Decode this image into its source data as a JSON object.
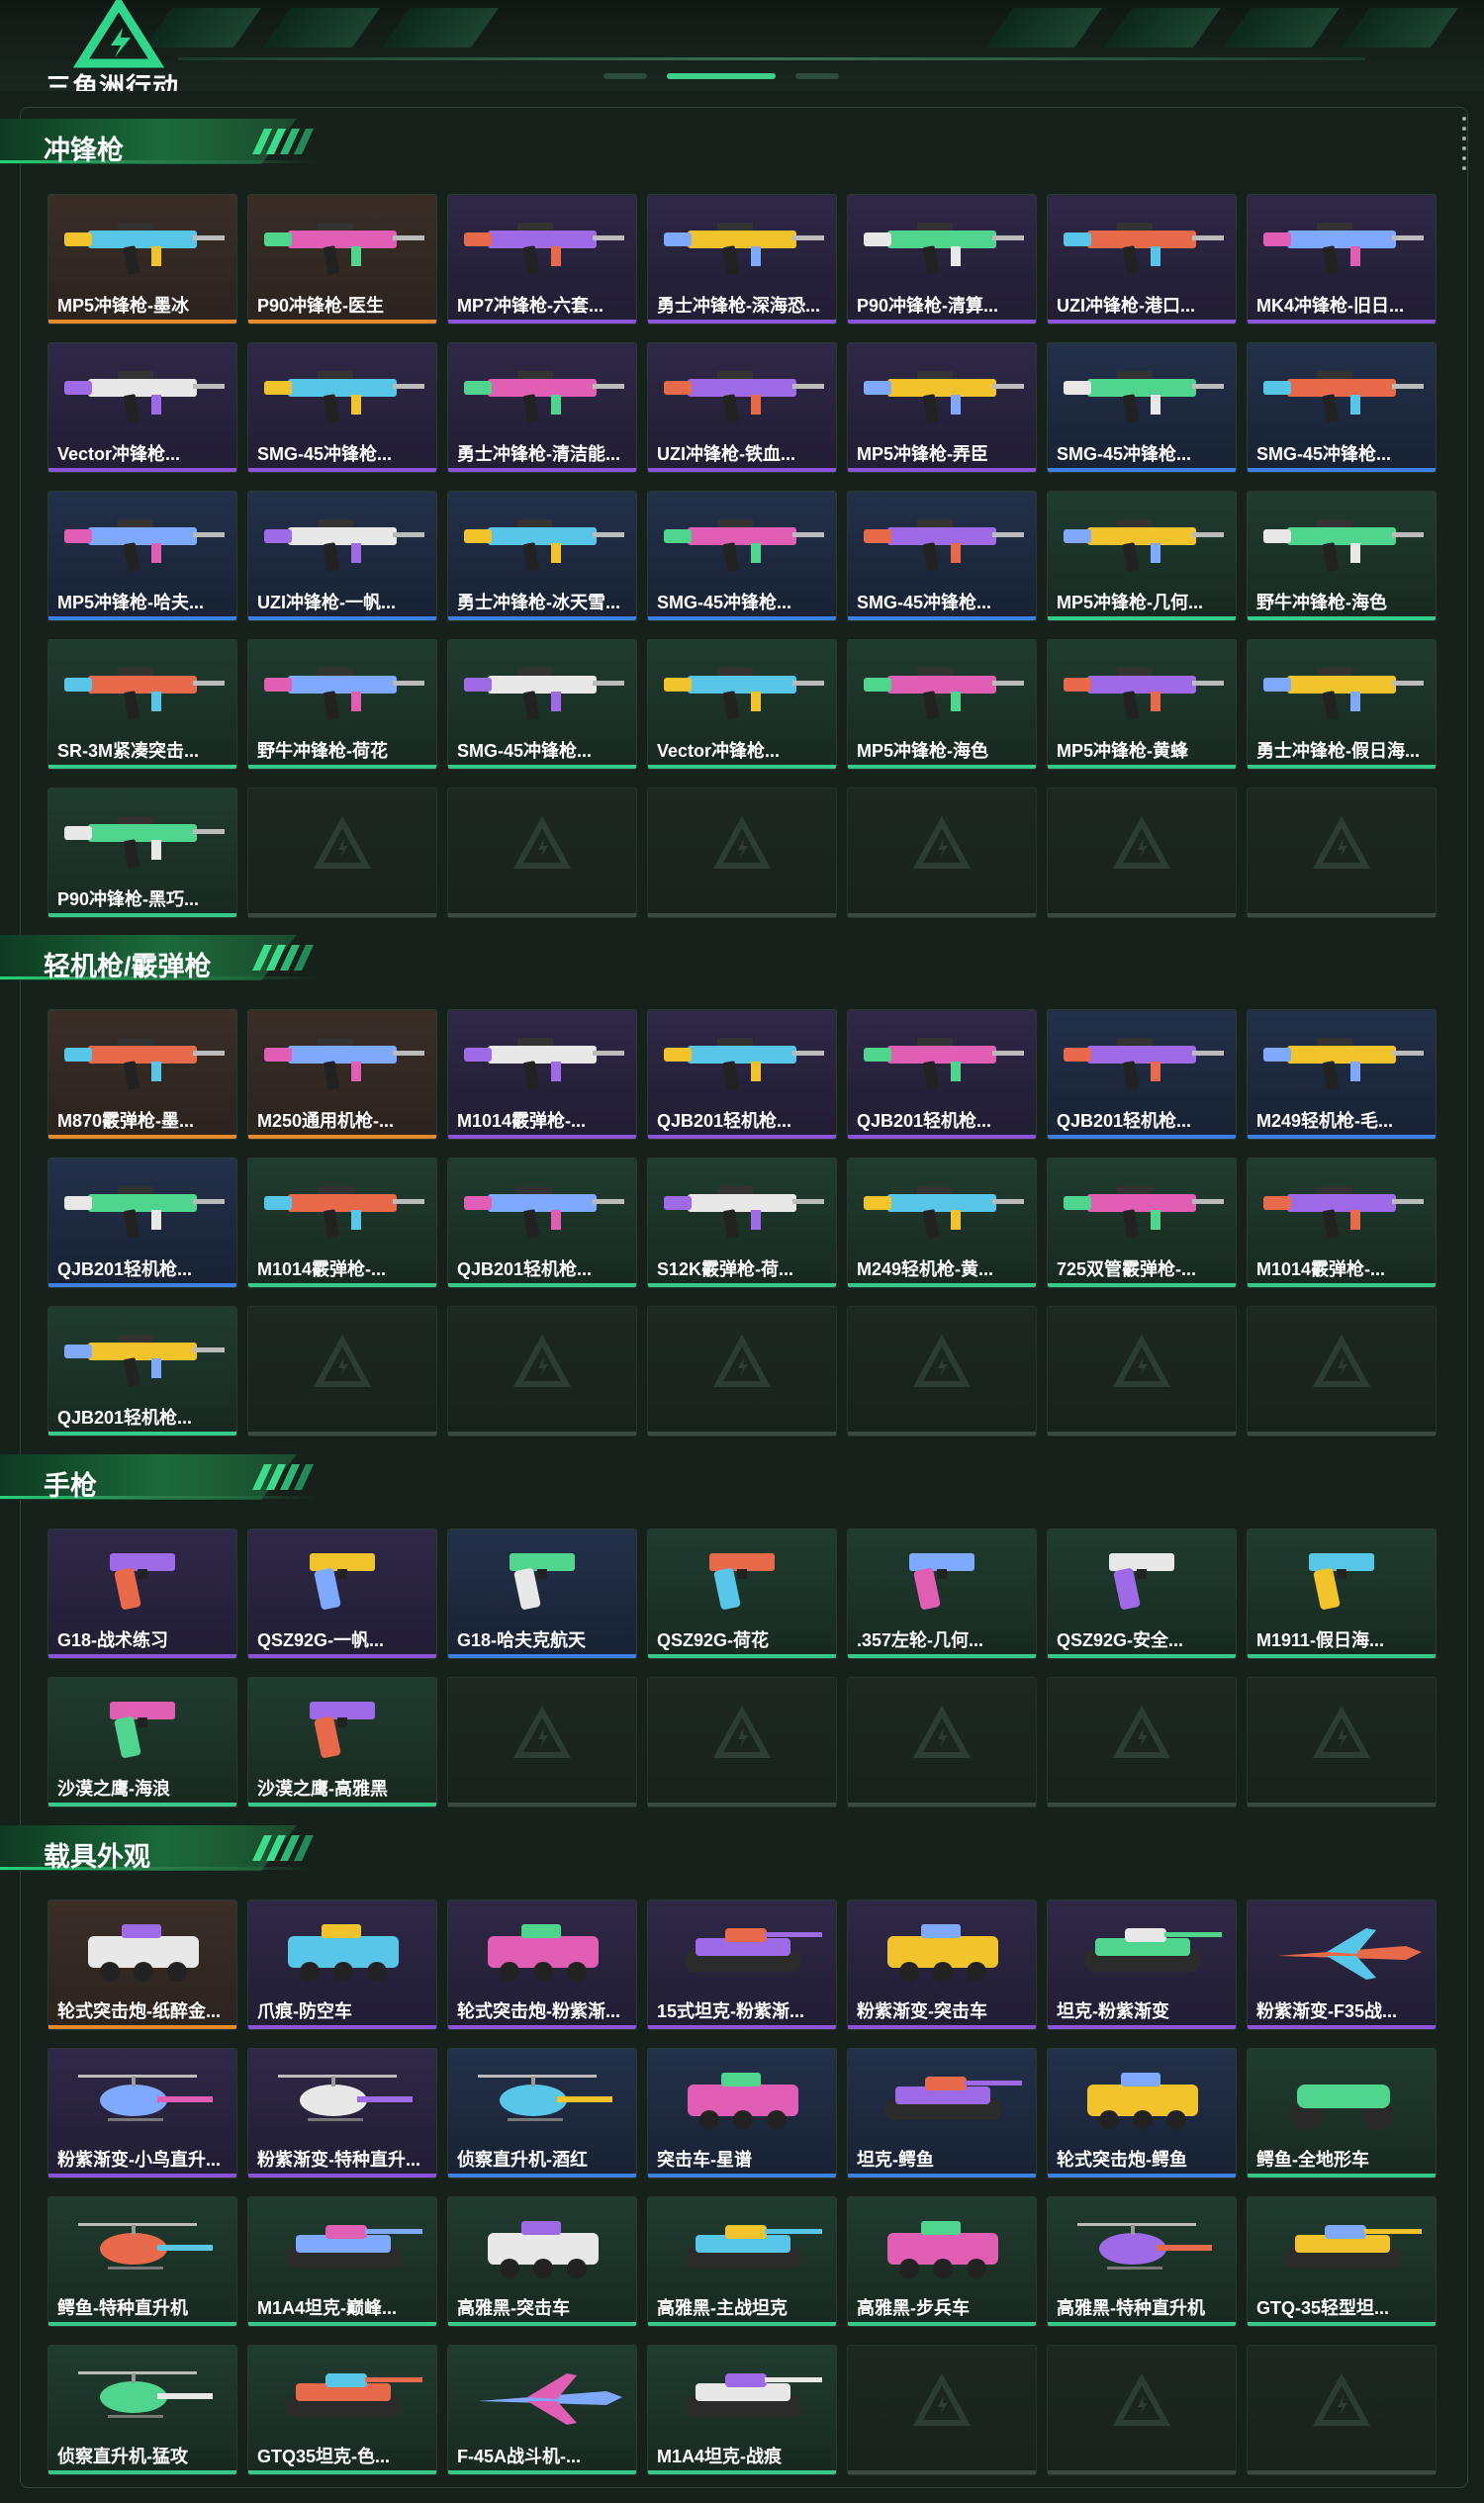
{
  "app": {
    "logo_text": "三角洲行动"
  },
  "colors": {
    "orange": "#e88a2a",
    "purple": "#8b54d8",
    "blue": "#3c7fe6",
    "green": "#36c98a",
    "accent": "#3fd18a"
  },
  "sections": [
    {
      "title": "冲锋枪",
      "items": [
        {
          "label": "MP5冲锋枪-墨冰",
          "rarity": "orange",
          "icon": "smg-icon"
        },
        {
          "label": "P90冲锋枪-医生",
          "rarity": "orange",
          "icon": "smg-icon"
        },
        {
          "label": "MP7冲锋枪-六套...",
          "rarity": "purple",
          "icon": "smg-icon"
        },
        {
          "label": "勇士冲锋枪-深海恐...",
          "rarity": "purple",
          "icon": "smg-icon"
        },
        {
          "label": "P90冲锋枪-清算...",
          "rarity": "purple",
          "icon": "smg-icon"
        },
        {
          "label": "UZI冲锋枪-港口...",
          "rarity": "purple",
          "icon": "smg-icon"
        },
        {
          "label": "MK4冲锋枪-旧日...",
          "rarity": "purple",
          "icon": "smg-icon"
        },
        {
          "label": "Vector冲锋枪...",
          "rarity": "purple",
          "icon": "smg-icon"
        },
        {
          "label": "SMG-45冲锋枪...",
          "rarity": "purple",
          "icon": "smg-icon"
        },
        {
          "label": "勇士冲锋枪-清洁能...",
          "rarity": "purple",
          "icon": "smg-icon"
        },
        {
          "label": "UZI冲锋枪-铁血...",
          "rarity": "purple",
          "icon": "smg-icon"
        },
        {
          "label": "MP5冲锋枪-弄臣",
          "rarity": "purple",
          "icon": "smg-icon"
        },
        {
          "label": "SMG-45冲锋枪...",
          "rarity": "blue",
          "icon": "smg-icon"
        },
        {
          "label": "SMG-45冲锋枪...",
          "rarity": "blue",
          "icon": "smg-icon"
        },
        {
          "label": "MP5冲锋枪-哈夫...",
          "rarity": "blue",
          "icon": "smg-icon"
        },
        {
          "label": "UZI冲锋枪-一帆...",
          "rarity": "blue",
          "icon": "smg-icon"
        },
        {
          "label": "勇士冲锋枪-冰天雪...",
          "rarity": "blue",
          "icon": "smg-icon"
        },
        {
          "label": "SMG-45冲锋枪...",
          "rarity": "blue",
          "icon": "smg-icon"
        },
        {
          "label": "SMG-45冲锋枪...",
          "rarity": "blue",
          "icon": "smg-icon"
        },
        {
          "label": "MP5冲锋枪-几何...",
          "rarity": "green",
          "icon": "smg-icon"
        },
        {
          "label": "野牛冲锋枪-海色",
          "rarity": "green",
          "icon": "smg-icon"
        },
        {
          "label": "SR-3M紧凑突击...",
          "rarity": "green",
          "icon": "smg-icon"
        },
        {
          "label": "野牛冲锋枪-荷花",
          "rarity": "green",
          "icon": "smg-icon"
        },
        {
          "label": "SMG-45冲锋枪...",
          "rarity": "green",
          "icon": "smg-icon"
        },
        {
          "label": "Vector冲锋枪...",
          "rarity": "green",
          "icon": "smg-icon"
        },
        {
          "label": "MP5冲锋枪-海色",
          "rarity": "green",
          "icon": "smg-icon"
        },
        {
          "label": "MP5冲锋枪-黄蜂",
          "rarity": "green",
          "icon": "smg-icon"
        },
        {
          "label": "勇士冲锋枪-假日海...",
          "rarity": "green",
          "icon": "smg-icon"
        },
        {
          "label": "P90冲锋枪-黑巧...",
          "rarity": "green",
          "icon": "smg-icon"
        }
      ]
    },
    {
      "title": "轻机枪/霰弹枪",
      "items": [
        {
          "label": "M870霰弹枪-墨...",
          "rarity": "orange",
          "icon": "shotgun-icon"
        },
        {
          "label": "M250通用机枪-...",
          "rarity": "orange",
          "icon": "lmg-icon"
        },
        {
          "label": "M1014霰弹枪-...",
          "rarity": "purple",
          "icon": "shotgun-icon"
        },
        {
          "label": "QJB201轻机枪...",
          "rarity": "purple",
          "icon": "lmg-icon"
        },
        {
          "label": "QJB201轻机枪...",
          "rarity": "purple",
          "icon": "lmg-icon"
        },
        {
          "label": "QJB201轻机枪...",
          "rarity": "blue",
          "icon": "lmg-icon"
        },
        {
          "label": "M249轻机枪-毛...",
          "rarity": "blue",
          "icon": "lmg-icon"
        },
        {
          "label": "QJB201轻机枪...",
          "rarity": "blue",
          "icon": "lmg-icon"
        },
        {
          "label": "M1014霰弹枪-...",
          "rarity": "green",
          "icon": "shotgun-icon"
        },
        {
          "label": "QJB201轻机枪...",
          "rarity": "green",
          "icon": "lmg-icon"
        },
        {
          "label": "S12K霰弹枪-荷...",
          "rarity": "green",
          "icon": "shotgun-icon"
        },
        {
          "label": "M249轻机枪-黄...",
          "rarity": "green",
          "icon": "lmg-icon"
        },
        {
          "label": "725双管霰弹枪-...",
          "rarity": "green",
          "icon": "shotgun-icon"
        },
        {
          "label": "M1014霰弹枪-...",
          "rarity": "green",
          "icon": "shotgun-icon"
        },
        {
          "label": "QJB201轻机枪...",
          "rarity": "green",
          "icon": "lmg-icon"
        }
      ]
    },
    {
      "title": "手枪",
      "items": [
        {
          "label": "G18-战术练习",
          "rarity": "purple",
          "icon": "pistol-icon"
        },
        {
          "label": "QSZ92G-一帆...",
          "rarity": "purple",
          "icon": "pistol-icon"
        },
        {
          "label": "G18-哈夫克航天",
          "rarity": "blue",
          "icon": "pistol-icon"
        },
        {
          "label": "QSZ92G-荷花",
          "rarity": "green",
          "icon": "pistol-icon"
        },
        {
          "label": ".357左轮-几何...",
          "rarity": "green",
          "icon": "revolver-icon"
        },
        {
          "label": "QSZ92G-安全...",
          "rarity": "green",
          "icon": "pistol-icon"
        },
        {
          "label": "M1911-假日海...",
          "rarity": "green",
          "icon": "pistol-icon"
        },
        {
          "label": "沙漠之鹰-海浪",
          "rarity": "green",
          "icon": "pistol-icon"
        },
        {
          "label": "沙漠之鹰-高雅黑",
          "rarity": "green",
          "icon": "pistol-icon"
        }
      ]
    },
    {
      "title": "载具外观",
      "items": [
        {
          "label": "轮式突击炮-纸醉金...",
          "rarity": "orange",
          "icon": "armored-vehicle-icon"
        },
        {
          "label": "爪痕-防空车",
          "rarity": "purple",
          "icon": "armored-vehicle-icon"
        },
        {
          "label": "轮式突击炮-粉紫渐...",
          "rarity": "purple",
          "icon": "armored-vehicle-icon"
        },
        {
          "label": "15式坦克-粉紫渐...",
          "rarity": "purple",
          "icon": "tank-icon"
        },
        {
          "label": "粉紫渐变-突击车",
          "rarity": "purple",
          "icon": "armored-vehicle-icon"
        },
        {
          "label": "坦克-粉紫渐变",
          "rarity": "purple",
          "icon": "tank-icon"
        },
        {
          "label": "粉紫渐变-F35战...",
          "rarity": "purple",
          "icon": "jet-icon"
        },
        {
          "label": "粉紫渐变-小鸟直升...",
          "rarity": "purple",
          "icon": "helicopter-icon"
        },
        {
          "label": "粉紫渐变-特种直升...",
          "rarity": "purple",
          "icon": "helicopter-icon"
        },
        {
          "label": "侦察直升机-酒红",
          "rarity": "blue",
          "icon": "helicopter-icon"
        },
        {
          "label": "突击车-星谱",
          "rarity": "blue",
          "icon": "armored-vehicle-icon"
        },
        {
          "label": "坦克-鳄鱼",
          "rarity": "blue",
          "icon": "tank-icon"
        },
        {
          "label": "轮式突击炮-鳄鱼",
          "rarity": "blue",
          "icon": "armored-vehicle-icon"
        },
        {
          "label": "鳄鱼-全地形车",
          "rarity": "green",
          "icon": "atv-icon"
        },
        {
          "label": "鳄鱼-特种直升机",
          "rarity": "green",
          "icon": "helicopter-icon"
        },
        {
          "label": "M1A4坦克-巅峰...",
          "rarity": "green",
          "icon": "tank-icon"
        },
        {
          "label": "高雅黑-突击车",
          "rarity": "green",
          "icon": "armored-vehicle-icon"
        },
        {
          "label": "高雅黑-主战坦克",
          "rarity": "green",
          "icon": "tank-icon"
        },
        {
          "label": "高雅黑-步兵车",
          "rarity": "green",
          "icon": "armored-vehicle-icon"
        },
        {
          "label": "高雅黑-特种直升机",
          "rarity": "green",
          "icon": "helicopter-icon"
        },
        {
          "label": "GTQ-35轻型坦...",
          "rarity": "green",
          "icon": "tank-icon"
        },
        {
          "label": "侦察直升机-猛攻",
          "rarity": "green",
          "icon": "helicopter-icon"
        },
        {
          "label": "GTQ35坦克-色...",
          "rarity": "green",
          "icon": "tank-icon"
        },
        {
          "label": "F-45A战斗机-...",
          "rarity": "green",
          "icon": "jet-icon"
        },
        {
          "label": "M1A4坦克-战痕",
          "rarity": "green",
          "icon": "tank-icon"
        }
      ]
    }
  ]
}
